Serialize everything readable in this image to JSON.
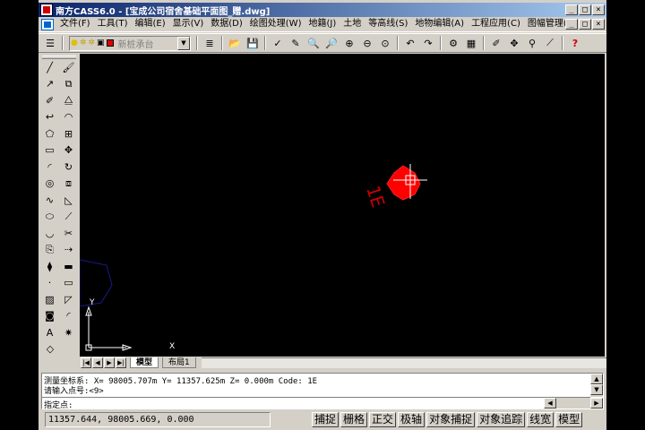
{
  "app": {
    "title": "南方CASS6.0 - [宝成公司宿舍基础平面图_赠.dwg]",
    "window_buttons": [
      "_",
      "□",
      "×"
    ]
  },
  "menu": {
    "items": [
      "文件(F)",
      "工具(T)",
      "编辑(E)",
      "显示(V)",
      "数据(D)",
      "绘图处理(W)",
      "地籍(J)",
      "土地",
      "等高线(S)",
      "地物编辑(A)",
      "工程应用(C)",
      "图幅管理(M)"
    ],
    "doc_buttons": [
      "_",
      "□",
      "×"
    ]
  },
  "toolbar": {
    "layer_name": "新桩承台",
    "layer_color": "#e00000",
    "icons": [
      "layers-icon",
      "lightbulb-icon",
      "sun-icon",
      "lock-icon",
      "color-swatch-icon"
    ],
    "right_icons": [
      {
        "name": "layer-prop-icon",
        "glyph": "≣"
      },
      {
        "name": "open-icon",
        "glyph": "📂"
      },
      {
        "name": "save-icon",
        "glyph": "💾"
      },
      {
        "name": "pencil-icon",
        "glyph": "✓"
      },
      {
        "name": "brush-icon",
        "glyph": "✎"
      },
      {
        "name": "zoom-realtime-icon",
        "glyph": "🔍"
      },
      {
        "name": "zoom-window-icon",
        "glyph": "🔎"
      },
      {
        "name": "zoom-all-icon",
        "glyph": "⊕"
      },
      {
        "name": "zoom-extents-icon",
        "glyph": "⊖"
      },
      {
        "name": "zoom-previous-icon",
        "glyph": "⊙"
      },
      {
        "name": "undo-icon",
        "glyph": "↶"
      },
      {
        "name": "redo-icon",
        "glyph": "↷"
      },
      {
        "name": "properties-icon",
        "glyph": "⚙"
      },
      {
        "name": "table-icon",
        "glyph": "▦"
      },
      {
        "name": "measure-icon",
        "glyph": "✐"
      },
      {
        "name": "pan-icon",
        "glyph": "✥"
      },
      {
        "name": "query-icon",
        "glyph": "⚲"
      },
      {
        "name": "line-tool-icon",
        "glyph": "⟋"
      },
      {
        "name": "help-icon",
        "glyph": "?"
      }
    ]
  },
  "left_toolbar": {
    "rows": [
      [
        {
          "name": "line-icon",
          "glyph": "╱"
        },
        {
          "name": "brush-tool-icon",
          "glyph": "🖌"
        }
      ],
      [
        {
          "name": "ray-icon",
          "glyph": "↗"
        },
        {
          "name": "copy-props-icon",
          "glyph": "⧉"
        }
      ],
      [
        {
          "name": "eraser-icon",
          "glyph": "✐"
        },
        {
          "name": "mirror-icon",
          "glyph": "⧋"
        }
      ],
      [
        {
          "name": "polyline-icon",
          "glyph": "↩"
        },
        {
          "name": "offset-icon",
          "glyph": "◠"
        }
      ],
      [
        {
          "name": "polygon-icon",
          "glyph": "⬠"
        },
        {
          "name": "array-icon",
          "glyph": "⊞"
        }
      ],
      [
        {
          "name": "rectangle-icon",
          "glyph": "▭"
        },
        {
          "name": "move-icon",
          "glyph": "✥"
        }
      ],
      [
        {
          "name": "arc-icon",
          "glyph": "◜"
        },
        {
          "name": "rotate-icon",
          "glyph": "↻"
        }
      ],
      [
        {
          "name": "circle-icon",
          "glyph": "◎"
        },
        {
          "name": "scale-icon",
          "glyph": "⧈"
        }
      ],
      [
        {
          "name": "spline-icon",
          "glyph": "∿"
        },
        {
          "name": "stretch-icon",
          "glyph": "◺"
        }
      ],
      [
        {
          "name": "ellipse-icon",
          "glyph": "⬭"
        },
        {
          "name": "lengthen-icon",
          "glyph": "⟋"
        }
      ],
      [
        {
          "name": "ellipse-arc-icon",
          "glyph": "◡"
        },
        {
          "name": "trim-icon",
          "glyph": "✂"
        }
      ],
      [
        {
          "name": "insert-block-icon",
          "glyph": "⎘"
        },
        {
          "name": "extend-icon",
          "glyph": "⇢"
        }
      ],
      [
        {
          "name": "make-block-icon",
          "glyph": "⧫"
        },
        {
          "name": "break-icon",
          "glyph": "▬"
        }
      ],
      [
        {
          "name": "point-icon",
          "glyph": "·"
        },
        {
          "name": "break-point-icon",
          "glyph": "▭"
        }
      ],
      [
        {
          "name": "hatch-icon",
          "glyph": "▨"
        },
        {
          "name": "chamfer-icon",
          "glyph": "◸"
        }
      ],
      [
        {
          "name": "region-icon",
          "glyph": "◙"
        },
        {
          "name": "fillet-icon",
          "glyph": "◜"
        }
      ],
      [
        {
          "name": "text-icon",
          "glyph": "A"
        },
        {
          "name": "explode-icon",
          "glyph": "✷"
        }
      ],
      [
        {
          "name": "tag-icon",
          "glyph": "◇"
        }
      ]
    ]
  },
  "canvas": {
    "point_label": "1E",
    "axis_y": "Y",
    "axis_x": "X"
  },
  "layout_tabs": {
    "nav_buttons": [
      "|◀",
      "◀",
      "▶",
      "▶|"
    ],
    "tabs": [
      "模型",
      "布局1"
    ]
  },
  "command": {
    "lines": [
      "测量坐标系: X= 98005.707m  Y= 11357.625m  Z= 0.000m  Code: 1E",
      "请输入点号:<9>",
      "指定点:"
    ]
  },
  "status": {
    "coords": "11357.644, 98005.669, 0.000",
    "toggles": [
      "捕捉",
      "栅格",
      "正交",
      "极轴",
      "对象捕捉",
      "对象追踪",
      "线宽",
      "模型"
    ]
  }
}
